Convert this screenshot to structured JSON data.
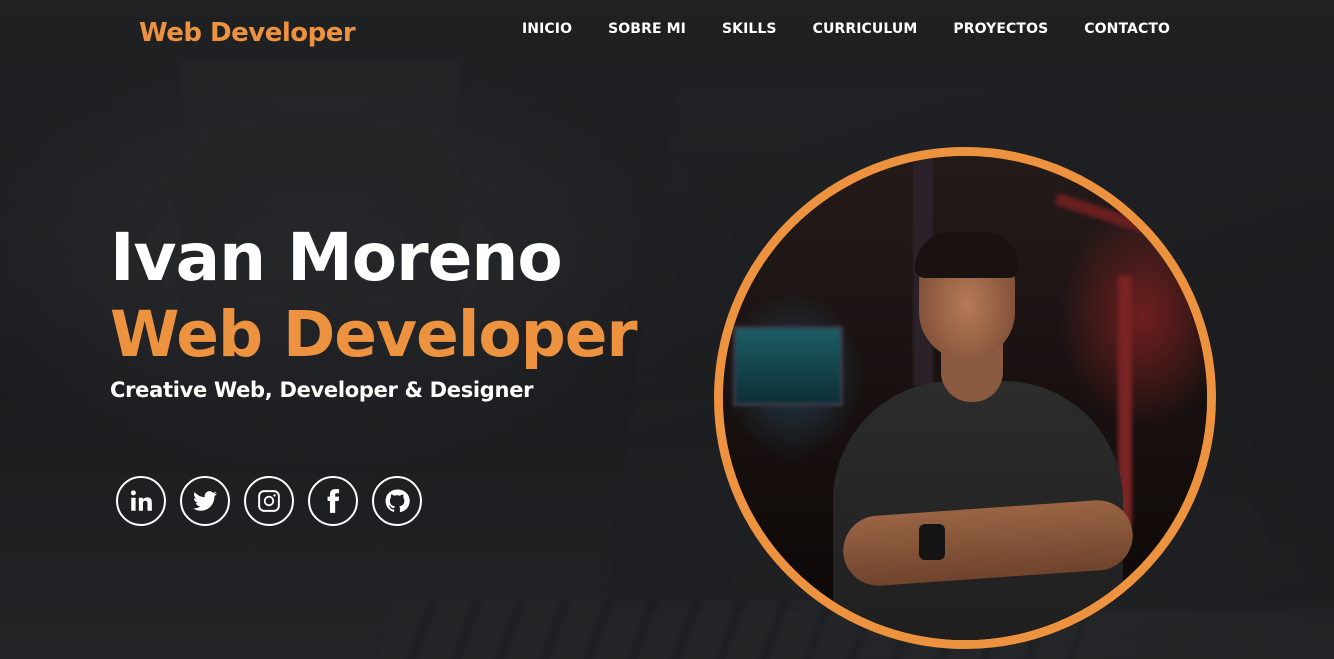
{
  "brand": {
    "name": "Web Developer"
  },
  "nav": {
    "items": [
      {
        "label": "INICIO"
      },
      {
        "label": "SOBRE MI"
      },
      {
        "label": "SKILLS"
      },
      {
        "label": "CURRICULUM"
      },
      {
        "label": "PROYECTOS"
      },
      {
        "label": "CONTACTO"
      }
    ]
  },
  "hero": {
    "name": "Ivan Moreno",
    "role": "Web Developer",
    "tagline": "Creative Web, Developer & Designer"
  },
  "socials": [
    {
      "icon": "linkedin-icon"
    },
    {
      "icon": "twitter-icon"
    },
    {
      "icon": "instagram-icon"
    },
    {
      "icon": "facebook-icon"
    },
    {
      "icon": "github-icon"
    }
  ],
  "colors": {
    "accent": "#ed923f",
    "text": "#ffffff",
    "background": "#1f2123"
  }
}
